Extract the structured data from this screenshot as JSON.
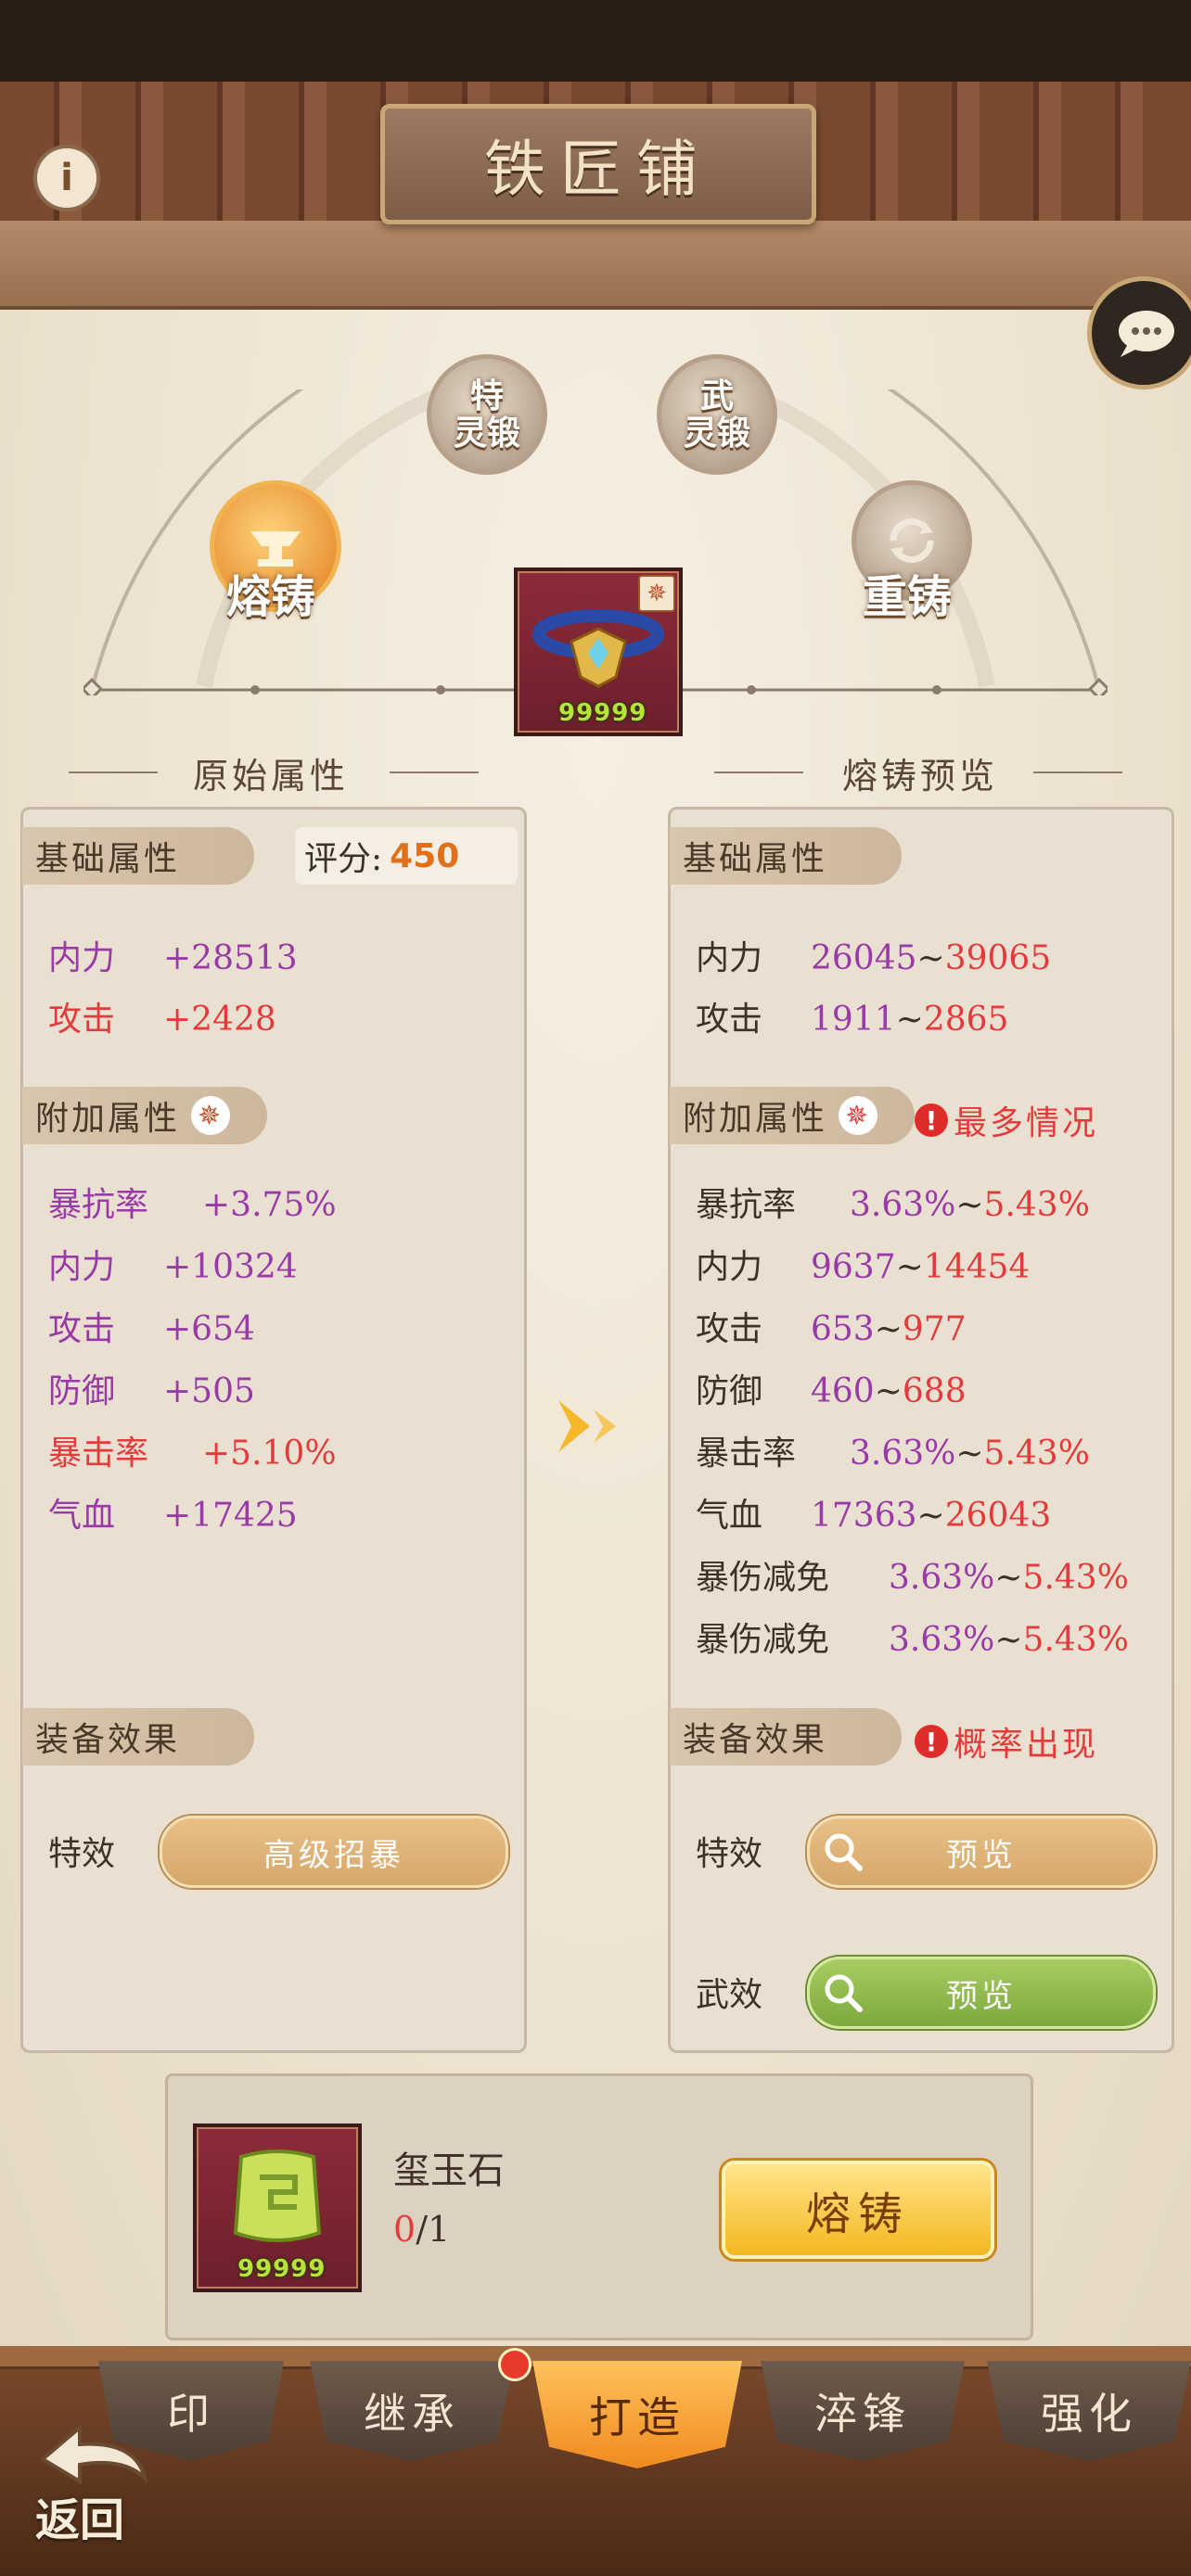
{
  "header": {
    "title": "铁匠铺"
  },
  "skills": {
    "smelt": "熔铸",
    "recast": "重铸",
    "special_forge": "特\n灵锻",
    "martial_forge": "武\n灵锻",
    "special_top": "特",
    "special_bottom": "灵锻",
    "martial_top": "武",
    "martial_bottom": "灵锻"
  },
  "item": {
    "count": "99999"
  },
  "left": {
    "section_title": "原始属性",
    "base_tag": "基础属性",
    "score_label": "评分:",
    "score_value": "450",
    "base_stats": [
      {
        "name": "内力",
        "value": "+28513"
      },
      {
        "name": "攻击",
        "value": "+2428"
      }
    ],
    "extra_tag": "附加属性",
    "extra_stats": [
      {
        "name": "暴抗率",
        "value": "+3.75%"
      },
      {
        "name": "内力",
        "value": "+10324"
      },
      {
        "name": "攻击",
        "value": "+654"
      },
      {
        "name": "防御",
        "value": "+505"
      },
      {
        "name": "暴击率",
        "value": "+5.10%"
      },
      {
        "name": "气血",
        "value": "+17425"
      }
    ],
    "effect_tag": "装备效果",
    "effect_label": "特效",
    "effect_value": "高级招暴"
  },
  "right": {
    "section_title": "熔铸预览",
    "base_tag": "基础属性",
    "base_stats": [
      {
        "name": "内力",
        "min": "26045",
        "max": "39065"
      },
      {
        "name": "攻击",
        "min": "1911",
        "max": "2865"
      }
    ],
    "extra_tag": "附加属性",
    "extra_note": "最多情况",
    "extra_stats": [
      {
        "name": "暴抗率",
        "min": "3.63%",
        "max": "5.43%"
      },
      {
        "name": "内力",
        "min": "9637",
        "max": "14454"
      },
      {
        "name": "攻击",
        "min": "653",
        "max": "977"
      },
      {
        "name": "防御",
        "min": "460",
        "max": "688"
      },
      {
        "name": "暴击率",
        "min": "3.63%",
        "max": "5.43%"
      },
      {
        "name": "气血",
        "min": "17363",
        "max": "26043"
      },
      {
        "name": "暴伤减免",
        "min": "3.63%",
        "max": "5.43%"
      },
      {
        "name": "暴伤减免",
        "min": "3.63%",
        "max": "5.43%"
      }
    ],
    "effect_tag": "装备效果",
    "effect_note": "概率出现",
    "effect1_label": "特效",
    "effect2_label": "武效",
    "preview_label": "预览"
  },
  "material": {
    "name": "玺玉石",
    "have": "0",
    "need": "/1",
    "count": "99999"
  },
  "smelt_button": "熔铸",
  "tabs": [
    "印",
    "继承",
    "打造",
    "淬锋",
    "强化"
  ],
  "back_label": "返回",
  "tilde": "~",
  "colors": {
    "purple": "#9a3aa6",
    "red": "#e53a3a",
    "orange": "#e0701a",
    "active_tab": "#f08a1e"
  }
}
